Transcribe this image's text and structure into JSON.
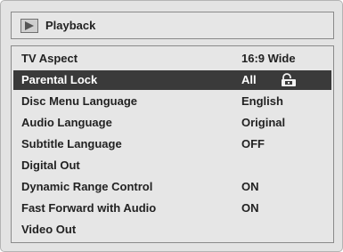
{
  "header": {
    "title": "Playback",
    "icon": "play-icon"
  },
  "colors": {
    "screen_background": "#e3e3e3",
    "panel_background": "#e6e6e6",
    "highlight_row": "#3a3a3a",
    "text": "#222222",
    "highlight_text": "#ffffff"
  },
  "menu": {
    "items": [
      {
        "label": "TV Aspect",
        "value": "16:9 Wide",
        "selected": false
      },
      {
        "label": "Parental Lock",
        "value": "All",
        "selected": true,
        "icon": "lock-icon"
      },
      {
        "label": "Disc Menu Language",
        "value": "English",
        "selected": false
      },
      {
        "label": "Audio Language",
        "value": "Original",
        "selected": false
      },
      {
        "label": "Subtitle Language",
        "value": "OFF",
        "selected": false
      },
      {
        "label": "Digital Out",
        "value": "",
        "selected": false
      },
      {
        "label": "Dynamic Range Control",
        "value": "ON",
        "selected": false
      },
      {
        "label": "Fast Forward with Audio",
        "value": "ON",
        "selected": false
      },
      {
        "label": "Video Out",
        "value": "",
        "selected": false
      }
    ]
  }
}
